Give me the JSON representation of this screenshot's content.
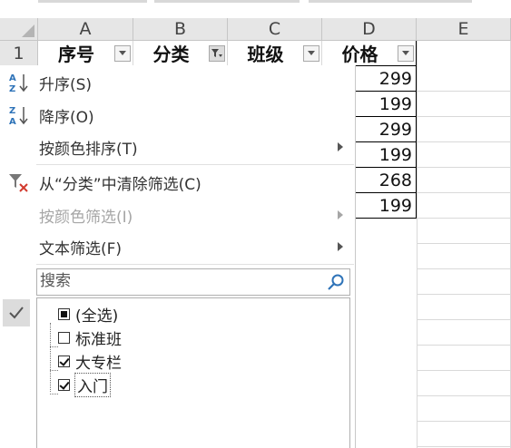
{
  "columns": [
    "A",
    "B",
    "C",
    "D",
    "E"
  ],
  "row_numbers": [
    "1"
  ],
  "header_row": {
    "col_a": "序号",
    "col_b": "分类",
    "col_c": "班级",
    "col_d": "价格"
  },
  "price_values": [
    "299",
    "199",
    "299",
    "199",
    "268",
    "199"
  ],
  "menu": {
    "sort_asc": "升序(S)",
    "sort_desc": "降序(O)",
    "sort_by_color": "按颜色排序(T)",
    "clear_filter": "从“分类”中清除筛选(C)",
    "filter_by_color": "按颜色筛选(I)",
    "text_filter": "文本筛选(F)"
  },
  "search": {
    "placeholder": "搜索"
  },
  "filter_list": [
    {
      "label": "(全选)",
      "state": "indeterminate"
    },
    {
      "label": "标准班",
      "state": "unchecked"
    },
    {
      "label": "大专栏",
      "state": "checked"
    },
    {
      "label": "入门",
      "state": "checked"
    }
  ],
  "colors": {
    "header_bg": "#e6e6e6",
    "grid": "#d9d9d9",
    "icon_blue": "#2e73b8",
    "icon_red": "#d23b2f"
  }
}
